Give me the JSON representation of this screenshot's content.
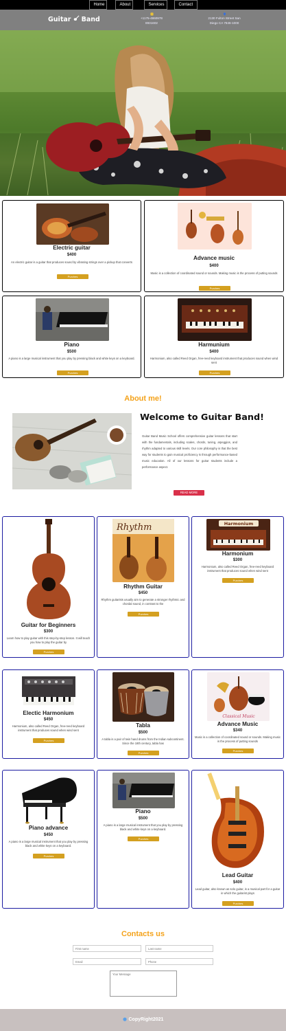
{
  "nav": {
    "items": [
      "Home",
      "About",
      "Services",
      "Contact"
    ]
  },
  "header": {
    "brand_left": "Guitar",
    "brand_right": "Band",
    "phone": "+1175-4860978",
    "phone_ext": "8931602",
    "address": "2130 Fulton Street San",
    "address2": "Diego CA 7846-1000"
  },
  "products_top": [
    {
      "title": "Electric guitar",
      "price": "$400",
      "desc": "An electric guitar is a guitar that produces sound by vibrating strings over a pickup that converts",
      "button": "Purches"
    },
    {
      "title": "Advance music",
      "price": "$400",
      "desc": "Music is a collection of coordinated sound or sounds. Making music is the process of putting sounds",
      "button": "Purches"
    },
    {
      "title": "Piano",
      "price": "$500",
      "desc": "A piano is a large musical instrument that you play by pressing black and white keys on a keyboard.",
      "button": "Purches"
    },
    {
      "title": "Harmunium",
      "price": "$400",
      "desc": "Harmonium, also called Reed Organ, free-reed keyboard instrument that produces sound when wind sent",
      "button": "Purches"
    }
  ],
  "about": {
    "section_title": "About me!",
    "heading": "Welcome to Guitar Band!",
    "body": "Guitar Band Music School offers comprehensive guitar lessons that start with the fundamentals, including scales, chords, tuning, arpeggios, and rhythm adapted to various skill levels. Our core philosophy is that the best way for students to gain musical proficiency is through performance-based music education. All of our lessons for guitar students include a performance aspect.",
    "button": "READ MORE"
  },
  "products_grid": [
    {
      "title": "Guitar for Beginners",
      "price": "$300",
      "desc": "Learn how to play guitar with this step-by-step lesson. It will teach you how to play the guitar by",
      "button": "Purches"
    },
    {
      "title": "Rhythm Guitar",
      "price": "$450",
      "desc": "Rhythm guitarists usually aim to generate a stronger rhythmic and chordal sound, in contrast to the",
      "button": "Purches",
      "img_text": "Rhythm"
    },
    {
      "title": "Harmonium",
      "price": "$300",
      "desc": "Harmonium, also called Reed Organ, free-reed keyboard instrument that produces sound when wind sent",
      "button": "Purches",
      "img_text": "Harmonium"
    },
    {
      "title": "Electic Harmonium",
      "price": "$450",
      "desc": "Harmonium, also called Reed Organ, free-reed keyboard instrument that produces sound when wind sent",
      "button": "Purches"
    },
    {
      "title": "Tabla",
      "price": "$500",
      "desc": "A tabla is a pair of twin hand drums from the Indian subcontinent. Since the 18th century, tabla has",
      "button": "Purches"
    },
    {
      "title": "Advance Music",
      "price": "$340",
      "desc": "Music is a collection of coordinated sound or sounds. Making music is the process of putting sounds",
      "button": "Purches",
      "img_text": "Classical Music"
    },
    {
      "title": "Piano advance",
      "price": "$450",
      "desc": "A piano is a large musical instrument that you play by pressing black and white keys on a keyboard.",
      "button": "Purches"
    },
    {
      "title": "Piano",
      "price": "$500",
      "desc": "A piano is a large musical instrument that you play by pressing black and white keys on a keyboard.",
      "button": "Purches"
    },
    {
      "title": "Lead Guitar",
      "price": "$400",
      "desc": "Lead guitar, also known as solo guitar, is a musical part for a guitar in which the guitarist plays",
      "button": "Purches"
    }
  ],
  "contact": {
    "section_title": "Contacts us",
    "first_name": "First name",
    "last_name": "Last name",
    "email": "Email",
    "phone": "Phone",
    "message": "Your Message"
  },
  "footer": {
    "text": "CopyRight2021"
  },
  "colors": {
    "accent": "#f4a21a",
    "button": "#d4a020",
    "read_more": "#d9304a",
    "footer": "#c8c0bf"
  }
}
